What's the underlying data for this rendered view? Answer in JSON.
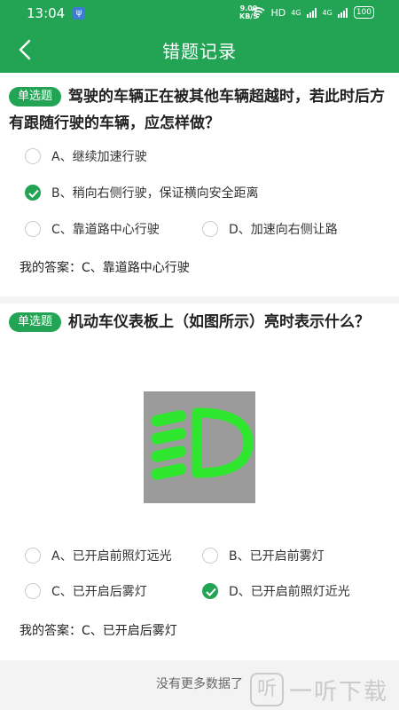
{
  "status_bar": {
    "time": "13:04",
    "net_speed_value": "9.00",
    "net_speed_unit": "KB/S",
    "hd": "HD",
    "sim1": "4G",
    "sim2": "4G",
    "battery": "100"
  },
  "app_bar": {
    "title": "错题记录"
  },
  "questions": [
    {
      "type": "单选题",
      "text": "驾驶的车辆正在被其他车辆超越时，若此时后方有跟随行驶的车辆，应怎样做？",
      "options": [
        "A、继续加速行驶",
        "B、稍向右侧行驶，保证横向安全距离",
        "C、靠道路中心行驶",
        "D、加速向右侧让路"
      ],
      "correct_index": 1,
      "my_answer_label": "我的答案：",
      "my_answer": "C、靠道路中心行驶"
    },
    {
      "type": "单选题",
      "text": "机动车仪表板上（如图所示）亮时表示什么？",
      "options": [
        "A、已开启前照灯远光",
        "B、已开启前雾灯",
        "C、已开启后雾灯",
        "D、已开启前照灯近光"
      ],
      "correct_index": 3,
      "my_answer_label": "我的答案：",
      "my_answer": "C、已开启后雾灯"
    }
  ],
  "footer": {
    "no_more": "没有更多数据了"
  },
  "watermark": {
    "logo_glyph": "听",
    "text": "一听下载"
  },
  "colors": {
    "primary": "#23a455",
    "icon_green": "#2ee62e"
  }
}
